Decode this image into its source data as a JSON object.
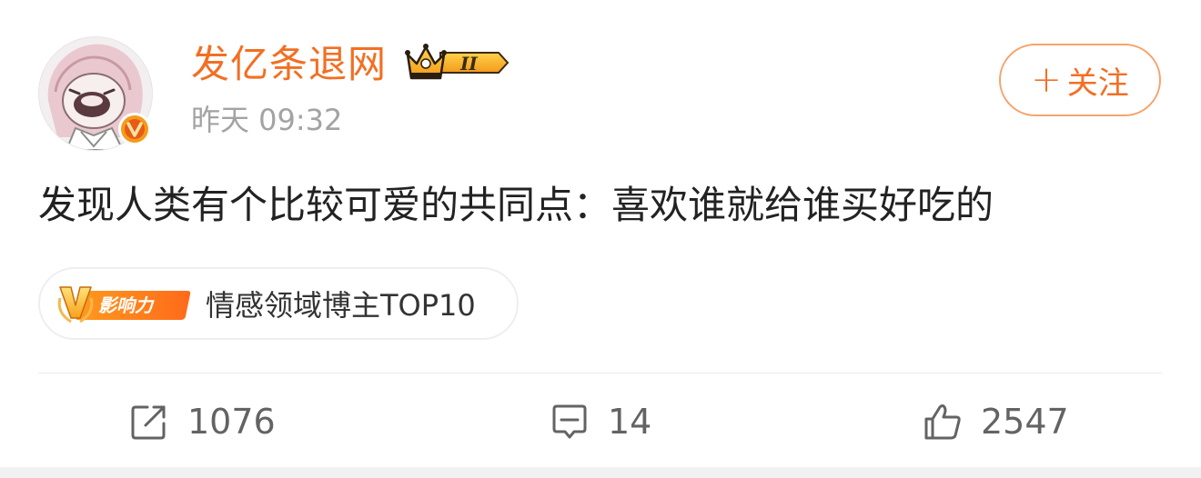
{
  "author": {
    "name": "发亿条退网",
    "avatar_icon": "cartoon-avatar",
    "verified_icon": "verified-v-badge",
    "member_badge_icon": "crown-level-ii-badge",
    "post_time": "昨天 09:32"
  },
  "follow_button": {
    "plus_glyph": "+",
    "label": "关注"
  },
  "post": {
    "text": "发现人类有个比较可爱的共同点：喜欢谁就给谁买好吃的"
  },
  "influence_tag": {
    "badge_icon": "v-influence-badge",
    "text": "情感领域博主TOP10"
  },
  "actions": {
    "repost_count": "1076",
    "comment_count": "14",
    "like_count": "2547"
  },
  "colors": {
    "brand_orange": "#f26f23",
    "follow_border": "#f7a36c",
    "muted_text": "#a3a3a3",
    "body_text": "#222222",
    "action_text": "#636363"
  }
}
